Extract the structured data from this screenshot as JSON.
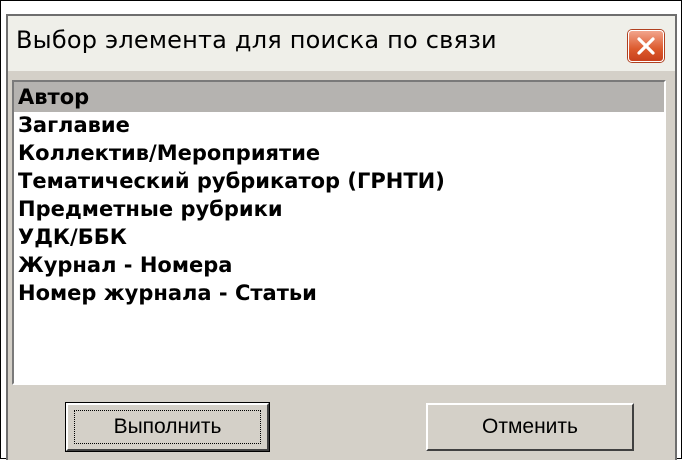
{
  "dialog": {
    "title": "Выбор элемента для поиска по связи",
    "close_icon": "close-icon",
    "items": [
      {
        "label": "Автор",
        "selected": true
      },
      {
        "label": "Заглавие",
        "selected": false
      },
      {
        "label": "Коллектив/Мероприятие",
        "selected": false
      },
      {
        "label": "Тематический рубрикатор (ГРНТИ)",
        "selected": false
      },
      {
        "label": "Предметные рубрики",
        "selected": false
      },
      {
        "label": "УДК/ББК",
        "selected": false
      },
      {
        "label": "Журнал - Номера",
        "selected": false
      },
      {
        "label": "Номер журнала - Статьи",
        "selected": false
      }
    ],
    "execute_label": "Выполнить",
    "cancel_label": "Отменить"
  },
  "colors": {
    "selection": "#b5b3b0",
    "dialog_bg": "#d4d0c8",
    "close_button": "#dc5a2d"
  }
}
